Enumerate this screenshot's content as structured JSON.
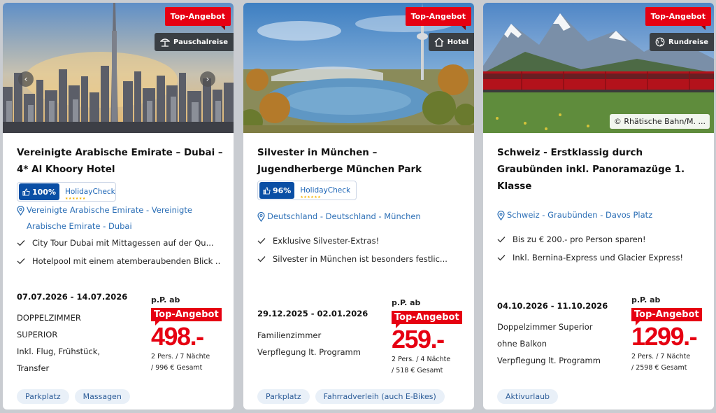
{
  "cards": [
    {
      "badge_top": "Top-Angebot",
      "badge_type": "Pauschalreise",
      "type_icon": "beach-umbrella-icon",
      "title": "Vereinigte Arabische Emirate – Dubai – 4* Al Khoory Hotel",
      "rating": {
        "percent": "100%",
        "brand": "HolidayCheck",
        "stars": "★★★★★★"
      },
      "location": "Vereinigte Arabische Emirate - Vereinigte Arabische Emirate - Dubai",
      "features": [
        "City Tour Dubai mit Mittagessen auf der Qu...",
        "Hotelpool mit einem atemberaubenden Blick ..."
      ],
      "dates": "07.07.2026 - 14.07.2026",
      "room_lines": [
        "DOPPELZIMMER",
        "SUPERIOR",
        "Inkl. Flug, Frühstück,",
        "Transfer"
      ],
      "price_label": "p.P. ab",
      "price_tag": "Top-Angebot",
      "price": "498.-",
      "price_sub1": "2 Pers. / 7 Nächte",
      "price_sub2": "/ 996 € Gesamt",
      "chips": [
        "Parkplatz",
        "Massagen"
      ]
    },
    {
      "badge_top": "Top-Angebot",
      "badge_type": "Hotel",
      "type_icon": "hotel-house-icon",
      "title": "Silvester in München – Jugendherberge München Park",
      "rating": {
        "percent": "96%",
        "brand": "HolidayCheck",
        "stars": "★★★★★★"
      },
      "location": "Deutschland - Deutschland - München",
      "features": [
        "Exklusive Silvester-Extras!",
        "Silvester in München ist besonders festlic..."
      ],
      "dates": "29.12.2025 - 02.01.2026",
      "room_lines": [
        "Familienzimmer",
        "Verpflegung lt. Programm"
      ],
      "price_label": "p.P. ab",
      "price_tag": "Top-Angebot",
      "price": "259.-",
      "price_sub1": "2 Pers. / 4 Nächte",
      "price_sub2": "/ 518 € Gesamt",
      "chips": [
        "Parkplatz",
        "Fahrradverleih (auch E-Bikes)"
      ]
    },
    {
      "badge_top": "Top-Angebot",
      "badge_type": "Rundreise",
      "type_icon": "globe-icon",
      "title": "Schweiz - Erstklassig durch Graubünden inkl. Panoramazüge 1. Klasse",
      "copyright": "© Rhätische Bahn/M. ...",
      "location": "Schweiz - Graubünden - Davos Platz",
      "features": [
        "Bis zu € 200.- pro Person sparen!",
        "Inkl. Bernina-Express und Glacier Express!"
      ],
      "dates": "04.10.2026 - 11.10.2026",
      "room_lines": [
        "Doppelzimmer Superior",
        "ohne Balkon",
        "Verpflegung lt. Programm"
      ],
      "price_label": "p.P. ab",
      "price_tag": "Top-Angebot",
      "price": "1299.-",
      "price_sub1": "2 Pers. / 7 Nächte",
      "price_sub2": "/ 2598 € Gesamt",
      "chips": [
        "Aktivurlaub"
      ]
    }
  ],
  "carousel": {
    "prev": "‹",
    "next": "›"
  }
}
